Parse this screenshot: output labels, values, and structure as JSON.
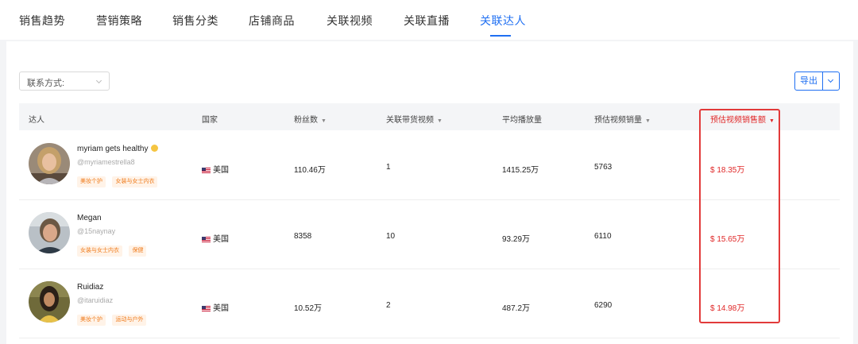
{
  "tabs": [
    {
      "label": "销售趋势",
      "active": false
    },
    {
      "label": "营销策略",
      "active": false
    },
    {
      "label": "销售分类",
      "active": false
    },
    {
      "label": "店铺商品",
      "active": false
    },
    {
      "label": "关联视频",
      "active": false
    },
    {
      "label": "关联直播",
      "active": false
    },
    {
      "label": "关联达人",
      "active": true
    }
  ],
  "filter": {
    "label": "联系方式:"
  },
  "export": {
    "label": "导出"
  },
  "table": {
    "headers": [
      {
        "label": "达人",
        "sortable": false
      },
      {
        "label": "国家",
        "sortable": false
      },
      {
        "label": "粉丝数",
        "sortable": true
      },
      {
        "label": "关联带货视频",
        "sortable": true
      },
      {
        "label": "平均播放量",
        "sortable": false
      },
      {
        "label": "预估视频销量",
        "sortable": true
      },
      {
        "label": "预估视频销售额",
        "sortable": true,
        "highlighted": true
      }
    ],
    "sort_icon": "▼",
    "rows": [
      {
        "name": "myriam gets healthy",
        "emoji": "smiling-face-emoji",
        "handle": "@myriamestrella8",
        "tags": [
          "美妆个护",
          "女装与女士内衣"
        ],
        "country": "美国",
        "followers": "110.46万",
        "videos": "1",
        "avg_views": "1415.25万",
        "est_sales": "5763",
        "est_revenue": "$ 18.35万"
      },
      {
        "name": "Megan",
        "handle": "@15naynay",
        "tags": [
          "女装与女士内衣",
          "保健"
        ],
        "country": "美国",
        "followers": "8358",
        "videos": "10",
        "avg_views": "93.29万",
        "est_sales": "6110",
        "est_revenue": "$ 15.65万"
      },
      {
        "name": "Ruidiaz",
        "handle": "@itaruidiaz",
        "tags": [
          "美妆个护",
          "运动与户外"
        ],
        "country": "美国",
        "followers": "10.52万",
        "videos": "2",
        "avg_views": "487.2万",
        "est_sales": "6290",
        "est_revenue": "$ 14.98万"
      }
    ]
  },
  "colors": {
    "accent": "#1f6ff2",
    "highlight": "#e02828",
    "tag_text": "#ef7a1a",
    "tag_bg": "#fff3e8"
  }
}
